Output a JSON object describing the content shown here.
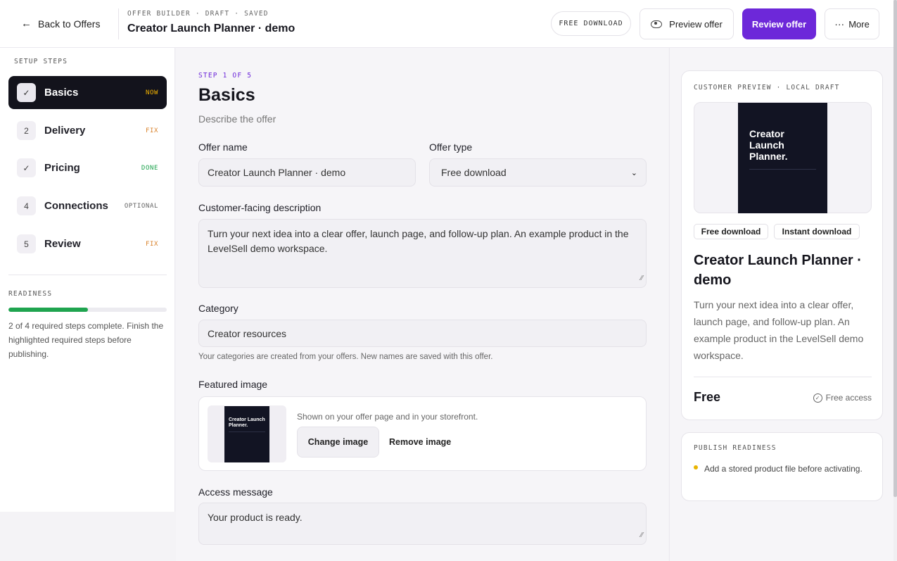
{
  "header": {
    "back_label": "Back to Offers",
    "crumb": "OFFER BUILDER · DRAFT · SAVED",
    "title": "Creator Launch Planner · demo",
    "type_pill": "FREE DOWNLOAD",
    "preview_label": "Preview offer",
    "review_label": "Review offer",
    "more_label": "More",
    "accent_color": "#6d28d9"
  },
  "sidebar": {
    "section_label": "SETUP STEPS",
    "steps": [
      {
        "badge": "✓",
        "label": "Basics",
        "tag": "NOW",
        "tag_color": "#f5b400"
      },
      {
        "badge": "2",
        "label": "Delivery",
        "tag": "FIX",
        "tag_color": "#d9822b"
      },
      {
        "badge": "✓",
        "label": "Pricing",
        "tag": "DONE",
        "tag_color": "#1fa44f"
      },
      {
        "badge": "4",
        "label": "Connections",
        "tag": "OPTIONAL",
        "tag_color": "#666666"
      },
      {
        "badge": "5",
        "label": "Review",
        "tag": "FIX",
        "tag_color": "#d9822b"
      }
    ],
    "readiness_label": "READINESS",
    "readiness_progress": 0.5,
    "readiness_text": "2 of 4 required steps complete. Finish the highlighted required steps before publishing."
  },
  "main": {
    "step_of": "STEP 1 OF 5",
    "title": "Basics",
    "subtitle": "Describe the offer",
    "offer_name_label": "Offer name",
    "offer_name_value": "Creator Launch Planner · demo",
    "offer_type_label": "Offer type",
    "offer_type_value": "Free download",
    "description_label": "Customer-facing description",
    "description_value": "Turn your next idea into a clear offer, launch page, and follow-up plan. An example product in the LevelSell demo workspace.",
    "category_label": "Category",
    "category_value": "Creator resources",
    "category_hint": "Your categories are created from your offers. New names are saved with this offer.",
    "featured_label": "Featured image",
    "featured_hint": "Shown on your offer page and in your storefront.",
    "change_image_label": "Change image",
    "remove_image_label": "Remove image",
    "thumb_title": "Creator Launch Planner.",
    "access_label": "Access message",
    "access_value": "Your product is ready."
  },
  "preview": {
    "label": "CUSTOMER PREVIEW · LOCAL DRAFT",
    "cover_title": "Creator Launch Planner.",
    "chip_1": "Free download",
    "chip_2": "Instant download",
    "title": "Creator Launch Planner · demo",
    "description": "Turn your next idea into a clear offer, launch page, and follow-up plan. An example product in the LevelSell demo workspace.",
    "price": "Free",
    "access": "Free access"
  },
  "publish": {
    "label": "PUBLISH READINESS",
    "item": "Add a stored product file before activating."
  }
}
